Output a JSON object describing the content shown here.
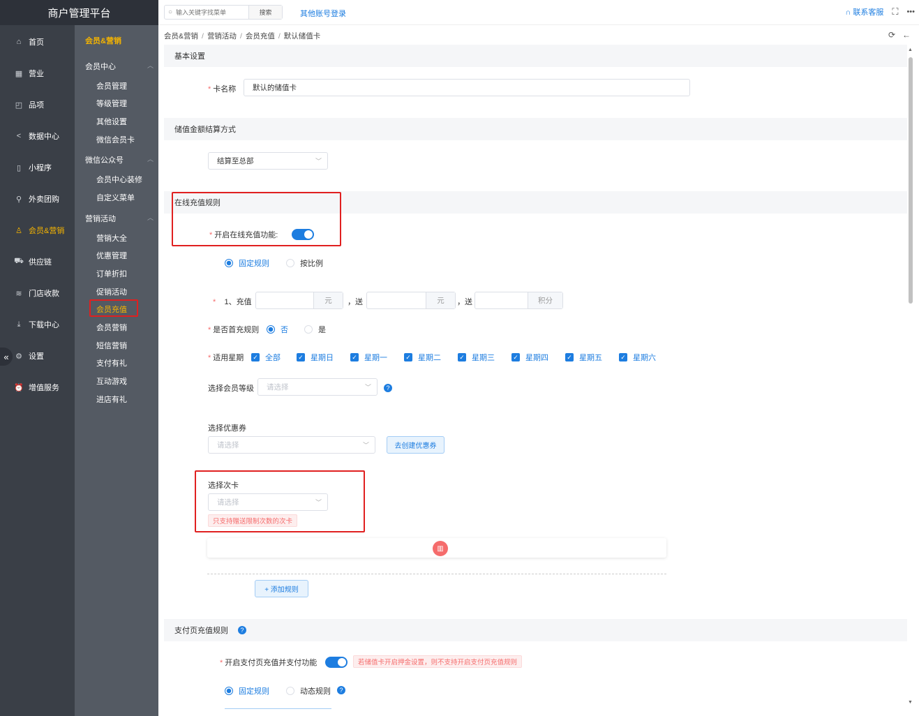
{
  "app": {
    "title": "商户管理平台"
  },
  "nav_primary": [
    {
      "label": "首页",
      "icon": "home-icon"
    },
    {
      "label": "营业",
      "icon": "calendar-icon"
    },
    {
      "label": "品项",
      "icon": "bag-icon"
    },
    {
      "label": "数据中心",
      "icon": "share-icon"
    },
    {
      "label": "小程序",
      "icon": "phone-icon"
    },
    {
      "label": "外卖团购",
      "icon": "bike-icon"
    },
    {
      "label": "会员&营销",
      "icon": "user-icon",
      "active": true
    },
    {
      "label": "供应链",
      "icon": "truck-icon"
    },
    {
      "label": "门店收款",
      "icon": "coins-icon"
    },
    {
      "label": "下载中心",
      "icon": "download-icon"
    },
    {
      "label": "设置",
      "icon": "gear-icon"
    },
    {
      "label": "增值服务",
      "icon": "alarm-icon"
    }
  ],
  "nav_secondary": {
    "title": "会员&营销",
    "groups": [
      {
        "label": "会员中心",
        "items": [
          "会员管理",
          "等级管理",
          "其他设置",
          "微信会员卡"
        ]
      },
      {
        "label": "微信公众号",
        "items": [
          "会员中心装修",
          "自定义菜单"
        ]
      },
      {
        "label": "营销活动",
        "items": [
          "营销大全",
          "优惠管理",
          "订单折扣",
          "促销活动",
          "会员充值",
          "会员营销",
          "短信营销",
          "支付有礼",
          "互动游戏",
          "进店有礼"
        ]
      }
    ],
    "active_item": "会员充值"
  },
  "topbar": {
    "search_placeholder": "输入关键字找菜单",
    "search_button": "搜索",
    "other_login": "其他账号登录",
    "support": "联系客服"
  },
  "breadcrumb": [
    "会员&营销",
    "营销活动",
    "会员充值",
    "默认储值卡"
  ],
  "sections": {
    "basic": {
      "title": "基本设置",
      "card_name_label": "卡名称",
      "card_name_value": "默认的储值卡"
    },
    "settle": {
      "title": "储值金额结算方式",
      "value": "结算至总部"
    },
    "online": {
      "title": "在线充值规则",
      "enable_label": "开启在线充值功能:",
      "rule_type": [
        "固定规则",
        "按比例"
      ],
      "rule_row": {
        "prefix": "1、充值",
        "unit1": "元",
        "mid": "，送",
        "unit2": "元",
        "mid2": "，送",
        "unit3": "积分"
      },
      "first_label": "是否首充规则",
      "first_options": [
        "否",
        "是"
      ],
      "weekday_label": "适用星期",
      "weekdays": [
        "全部",
        "星期日",
        "星期一",
        "星期二",
        "星期三",
        "星期四",
        "星期五",
        "星期六"
      ],
      "level_label": "选择会员等级",
      "level_placeholder": "请选择",
      "coupon_label": "选择优惠券",
      "coupon_placeholder": "请选择",
      "coupon_button": "去创建优惠券",
      "card_label": "选择次卡",
      "card_placeholder": "请选择",
      "card_tip": "只支持赠送限制次数的次卡",
      "add_rule": "+ 添加规则"
    },
    "pay": {
      "title": "支付页充值规则",
      "enable_label": "开启支付页充值并支付功能",
      "warn": "若储值卡开启押金设置，则不支持开启支付页充值规则",
      "rule_type": [
        "固定规则",
        "动态规则"
      ]
    }
  },
  "colors": {
    "accent": "#1d7de0",
    "active_nav": "#f5b400",
    "danger": "#f56c6c",
    "sidebar_dark": "#3a3f47",
    "sidebar_mid": "#545a63"
  }
}
